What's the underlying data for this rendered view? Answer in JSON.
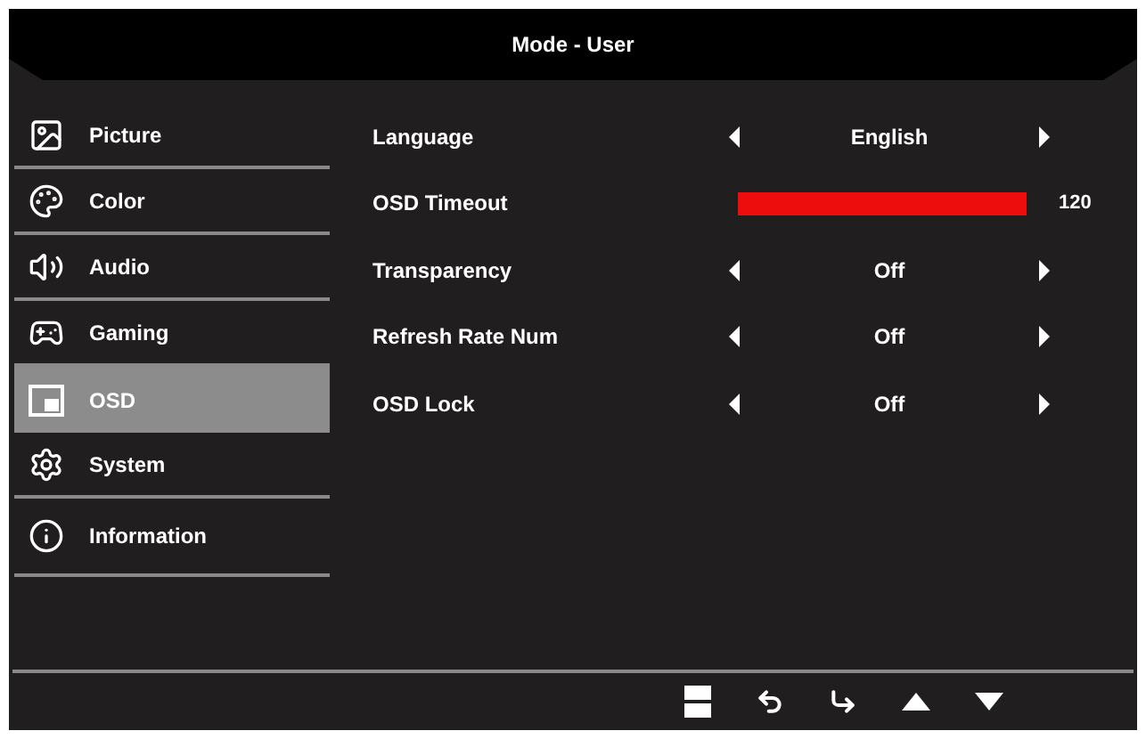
{
  "title": "Mode - User",
  "sidebar": {
    "items": [
      {
        "label": "Picture",
        "selected": false
      },
      {
        "label": "Color",
        "selected": false
      },
      {
        "label": "Audio",
        "selected": false
      },
      {
        "label": "Gaming",
        "selected": false
      },
      {
        "label": "OSD",
        "selected": true
      },
      {
        "label": "System",
        "selected": false
      },
      {
        "label": "Information",
        "selected": false
      }
    ]
  },
  "settings": [
    {
      "kind": "select",
      "label": "Language",
      "value": "English"
    },
    {
      "kind": "slider",
      "label": "OSD Timeout",
      "level": 1,
      "reading": "120"
    },
    {
      "kind": "select",
      "label": "Transparency",
      "value": "Off"
    },
    {
      "kind": "select",
      "label": "Refresh Rate Num",
      "value": "Off"
    },
    {
      "kind": "select",
      "label": "OSD Lock",
      "value": "Off"
    }
  ]
}
